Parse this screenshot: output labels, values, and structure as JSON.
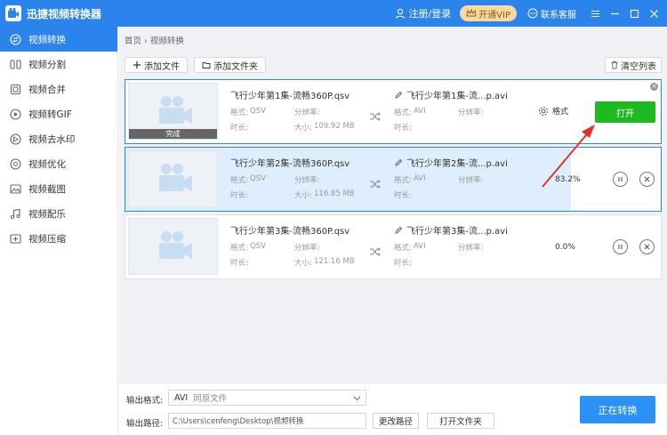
{
  "app": {
    "title": "迅捷视频转换器",
    "login": "注册/登录",
    "vip": "开通VIP",
    "service": "联系客服"
  },
  "sidebar": {
    "items": [
      {
        "label": "视频转换",
        "icon": "convert-icon"
      },
      {
        "label": "视频分割",
        "icon": "split-icon"
      },
      {
        "label": "视频合并",
        "icon": "merge-icon"
      },
      {
        "label": "视频转GIF",
        "icon": "gif-icon"
      },
      {
        "label": "视频去水印",
        "icon": "watermark-icon"
      },
      {
        "label": "视频优化",
        "icon": "optimize-icon"
      },
      {
        "label": "视频截图",
        "icon": "screenshot-icon"
      },
      {
        "label": "视频配乐",
        "icon": "music-icon"
      },
      {
        "label": "视频压缩",
        "icon": "compress-icon"
      }
    ]
  },
  "breadcrumb": {
    "home": "首页",
    "sep": "›",
    "current": "视频转换"
  },
  "toolbar": {
    "add_file": "添加文件",
    "add_folder": "添加文件夹",
    "clear": "清空列表"
  },
  "labels": {
    "format": "格式:",
    "resolution": "分辨率:",
    "duration": "时长:",
    "size": "大小:",
    "settings": "格式"
  },
  "files": [
    {
      "src_name": "飞行少年第1集-流畅360P.qsv",
      "src_format": "QSV",
      "size": "109.92 MB",
      "dst_name": "飞行少年第1集-流...p.avi",
      "dst_format": "AVI",
      "status": "完成",
      "open": "打开",
      "progress": 100
    },
    {
      "src_name": "飞行少年第2集-流畅360P.qsv",
      "src_format": "QSV",
      "size": "116.85 MB",
      "dst_name": "飞行少年第2集-流...p.avi",
      "dst_format": "AVI",
      "percent": "83.2%",
      "progress": 83.2
    },
    {
      "src_name": "飞行少年第3集-流畅360P.qsv",
      "src_format": "QSV",
      "size": "121.16 MB",
      "dst_name": "飞行少年第3集-流...p.avi",
      "dst_format": "AVI",
      "percent": "0.0%",
      "progress": 0
    }
  ],
  "footer": {
    "output_format_label": "输出格式:",
    "output_format": "AVI",
    "output_format_sub": "同原文件",
    "output_path_label": "输出路径:",
    "output_path": "C:\\Users\\cenfeng\\Desktop\\视频转换",
    "change_path": "更改路径",
    "open_folder": "打开文件夹",
    "convert": "正在转换"
  },
  "colors": {
    "accent": "#2b83ec",
    "open_button": "#1fb922",
    "arrow": "#e4322b"
  }
}
